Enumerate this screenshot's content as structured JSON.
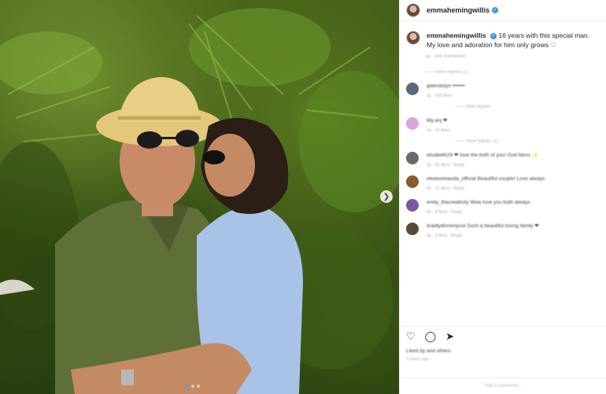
{
  "post": {
    "username": "emmahemingwillis",
    "caption": "16 years with this special man. My love and adoration for him only grows ♡",
    "caption_meta": "3y · See translation",
    "view_replies_1": "—— View replies (1)",
    "hide_replies": "—— Hide replies",
    "view_replies_2": "—— View replies (1)"
  },
  "comments": [
    {
      "text": "gwendolyn •••••••",
      "meta": "3y · 169 likes",
      "avatar_color": "#5a6a7a"
    },
    {
      "text": "lilly.anj ❤",
      "meta": "3y · 31 likes",
      "avatar_color": "#d9a6d9"
    },
    {
      "text": "elisabeth29 ❤ love the both of you! God bless ✨",
      "meta": "3y · 31 likes · Reply",
      "avatar_color": "#6a6a6a"
    },
    {
      "text": "eleanorwanda_official Beautiful couple! Love always",
      "meta": "3y · 12 likes · Reply",
      "avatar_color": "#8a5a2a"
    },
    {
      "text": "emily_thecreativity Wow love you both always",
      "meta": "3y · 8 likes · Reply",
      "avatar_color": "#7a5aa0"
    },
    {
      "text": "bradlydinnenpost Such a beautiful loving family ❤",
      "meta": "3y · 5 likes · Reply",
      "avatar_color": "#5a4a3a"
    }
  ],
  "footer": {
    "likes": "Liked by and others",
    "date": "3 years ago",
    "add_comment": "Add a comment..."
  },
  "icons": {
    "heart": "heart-icon",
    "comment": "comment-icon",
    "share": "share-icon",
    "verified": "verified-badge-icon",
    "next": "chevron-right-icon"
  }
}
